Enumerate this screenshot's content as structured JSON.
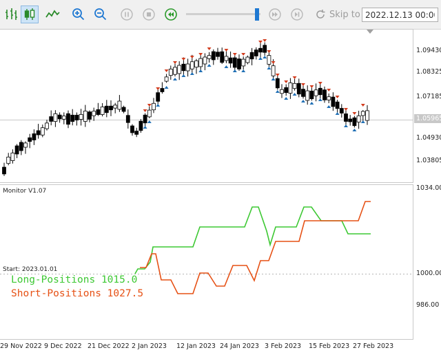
{
  "toolbar": {
    "buttons": [
      {
        "name": "bar-chart-icon",
        "color": "#2a8a2a"
      },
      {
        "name": "candlestick-chart-icon",
        "color": "#2a8a2a",
        "active": true
      },
      {
        "name": "line-chart-icon",
        "color": "#2a8a2a"
      },
      {
        "name": "zoom-in-icon",
        "color": "#1e78d2"
      },
      {
        "name": "zoom-out-icon",
        "color": "#1e78d2"
      },
      {
        "name": "pause-icon",
        "color": "#b8b8b8"
      },
      {
        "name": "stop-icon",
        "color": "#b8b8b8"
      },
      {
        "name": "rewind-icon",
        "color": "#2a9a2a"
      },
      {
        "name": "fast-forward-icon",
        "color": "#b8b8b8"
      },
      {
        "name": "step-end-icon",
        "color": "#b8b8b8"
      }
    ],
    "skip_to_label": "Skip to",
    "date_value": "2022.12.13 00:00"
  },
  "price_scale": {
    "ticks": [
      "1.09430",
      "1.08325",
      "1.07185",
      "1.04930",
      "1.03805"
    ],
    "current_price": "1.05965"
  },
  "indicator": {
    "title": "Monitor V1.07",
    "start_label": "Start: 2023.01.01",
    "long_label": "Long-Positions 1015.0",
    "short_label": "Short-Positions 1027.5",
    "long_color": "#3cc832",
    "short_color": "#e65014",
    "scale_ticks": [
      "1034.00",
      "1000.00",
      "986.00"
    ]
  },
  "time_axis": {
    "ticks": [
      "29 Nov 2022",
      "9 Dec 2022",
      "21 Dec 2022",
      "2 Jan 2023",
      "12 Jan 2023",
      "24 Jan 2023",
      "3 Feb 2023",
      "15 Feb 2023",
      "27 Feb 2023"
    ]
  },
  "colors": {
    "bull_candle": "#ffffff",
    "bear_candle": "#000000",
    "buy_arrow": "#1e6eb4",
    "sell_arrow": "#d23c1e",
    "grid": "#c8c8c8"
  }
}
